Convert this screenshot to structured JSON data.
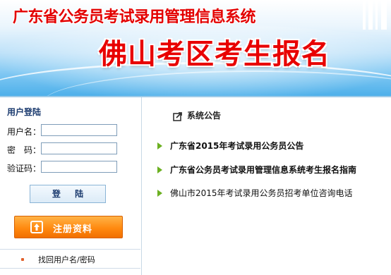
{
  "header": {
    "title": "广东省公务员考试录用管理信息系统",
    "subtitle": "佛山考区考生报名"
  },
  "login": {
    "title": "用户登陆",
    "username_label": "用户名：",
    "password_label": "密　码：",
    "captcha_label": "验证码：",
    "username_value": "",
    "password_value": "",
    "captcha_value": "",
    "login_button": "登  陆",
    "register_button": "注册资料",
    "find_link": "找回用户名/密码"
  },
  "announcements": {
    "title": "系统公告",
    "items": [
      {
        "text": "广东省2015年考试录用公务员公告"
      },
      {
        "text": "广东省公务员考试录用管理信息系统考生报名指南"
      },
      {
        "text": "佛山市2015年考试录用公务员招考单位咨询电话"
      }
    ]
  },
  "colors": {
    "title_red": "#e30000",
    "accent_orange": "#ff8a10",
    "bullet_green": "#6cb021",
    "heading_blue": "#1a3a6e"
  }
}
